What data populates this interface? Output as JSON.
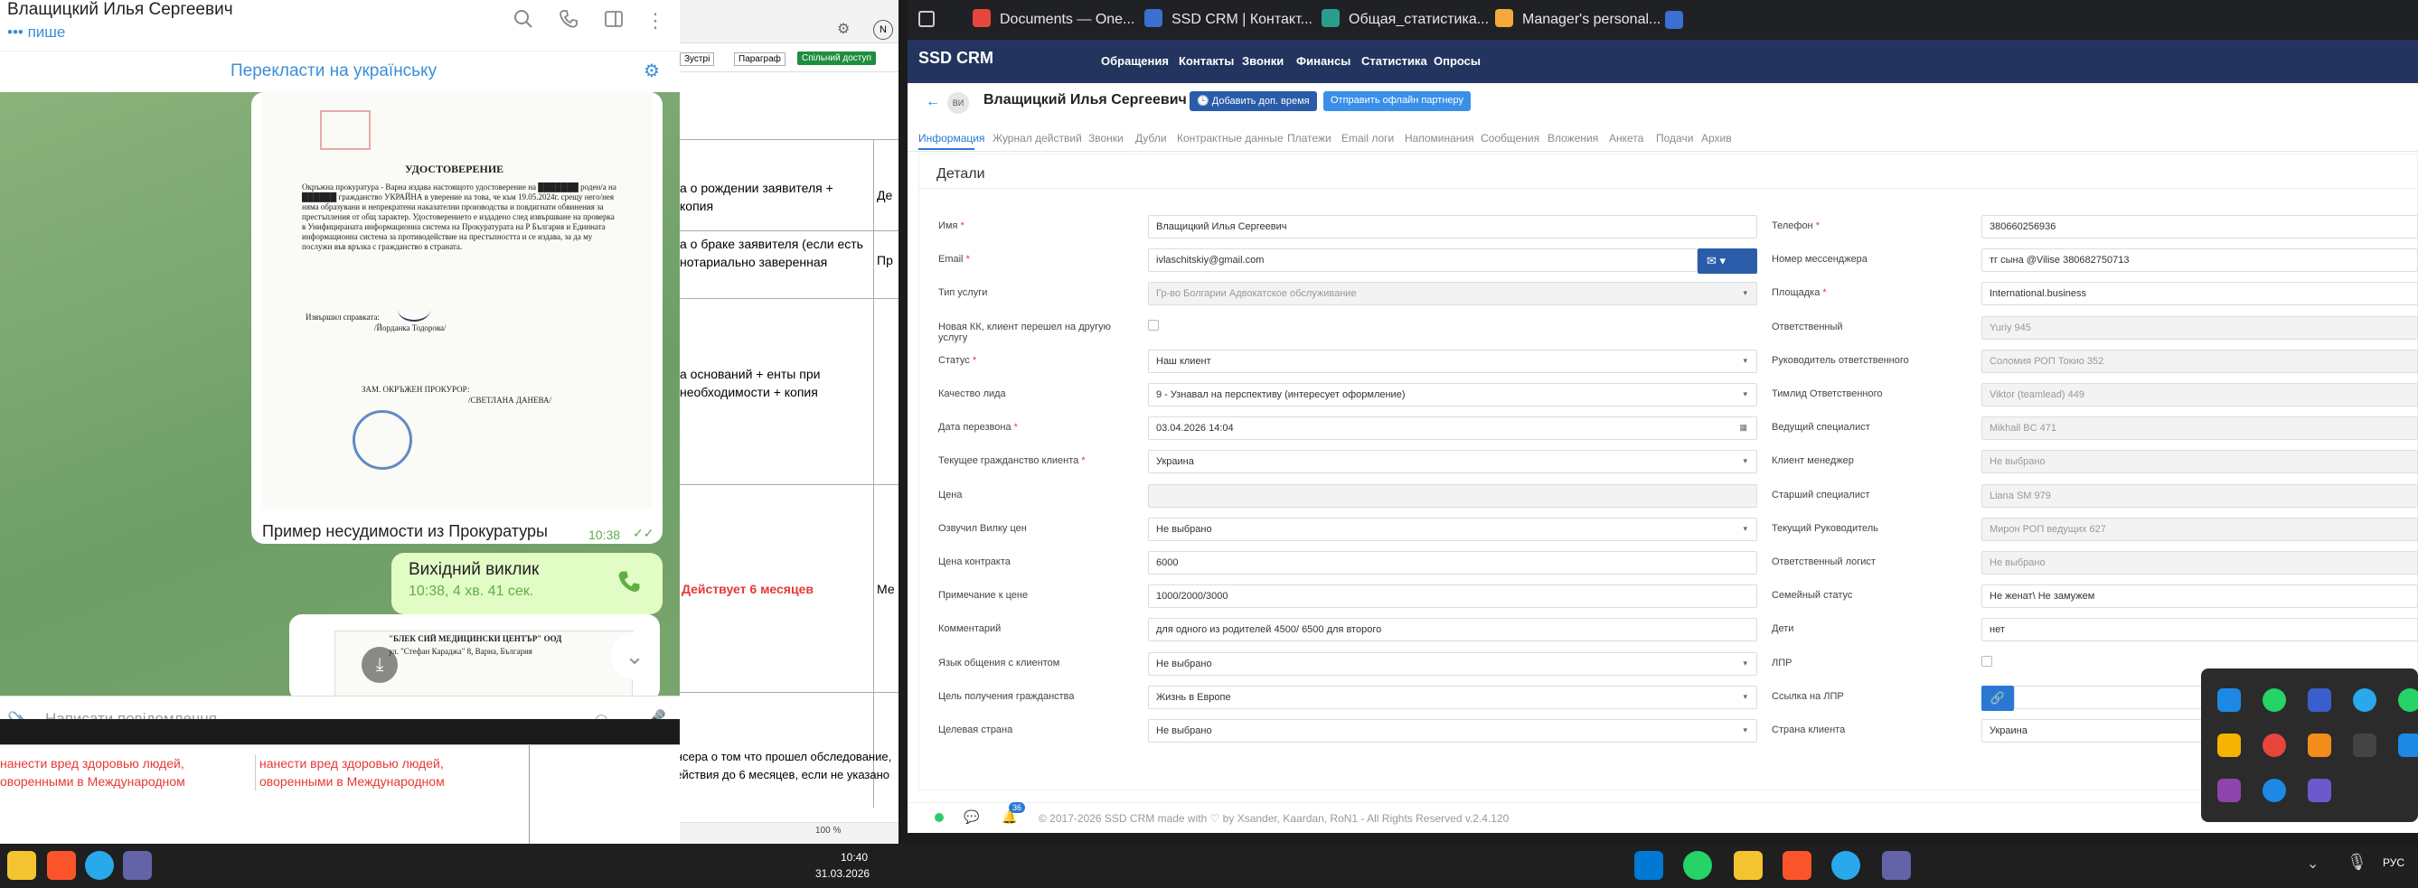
{
  "telegram": {
    "contact_name": "Влащицкий Илья Сергеевич",
    "status": "••• пише",
    "translate_label": "Перекласти на українську",
    "doc_title": "УДОСТОВЕРЕНИЕ",
    "doc_body": "Окръжна прокуратура - Варна издава настоящото удостоверение на ███████ роден/а на ██████ гражданство УКРАЙНА в уверение на това, че към 19.05.2024г. срещу него/нея няма образувани и непрекратени наказателни производства и повдигнати обвинения за престъпления от общ характер. Удостоверението е издадено след извършване на проверка в Унифицираната информационна система на Прокуратурата на Р България и Единната информационна система за противодействие на престъпността и се издава, за да му послужи във връзка с гражданство в страната.",
    "doc_signer_label": "Извършил справката:",
    "doc_signer": "/Йорданка Тодорова/",
    "doc_prosecutor_label": "ЗАМ. ОКРЪЖЕН ПРОКУРОР:",
    "doc_prosecutor": "/СВЕТЛАНА ДАНЕВА/",
    "message_caption": "Пример несудимости из Прокуратуры",
    "message_time": "10:38",
    "call_title": "Вихідний виклик",
    "call_sub": "10:38, 4 хв. 41 сек.",
    "doc2_line1": "\"БЛЕК СИЙ МЕДИЦИНСКИ ЦЕНТЪР\" ООД",
    "doc2_line2": "ул. \"Стефан Караджа\" 8, Варна, България",
    "compose_placeholder": "Написати повідомлення..."
  },
  "middle": {
    "menu_items": [
      "Зустрі",
      "Параграф",
      "Спільний доступ"
    ],
    "avatar_letter": "N",
    "rows": [
      {
        "text": "а о рождении заявителя + копия",
        "side": "Де"
      },
      {
        "text": "а о браке заявителя (если есть нотариально заверенная",
        "side": "Пр"
      },
      {
        "text": "а оснований + енты при необходимости + копия",
        "side": ""
      },
      {
        "text": "Действует 6 месяцев",
        "side": "Ме"
      },
      {
        "text": "Справка с психнерв диспансера о том что прошел обследование, психически здоров (срок действия до 6 месяцев, если не указано срок годности).",
        "side": ""
      }
    ],
    "red_text": "нанести вред здоровью людей, оворенными в Международном",
    "zoom": "100 %"
  },
  "browser_tabs": [
    {
      "label": "Documents — One...",
      "color": "#e8453c"
    },
    {
      "label": "SSD CRM | Контакт...",
      "color": "#3b6fd1"
    },
    {
      "label": "Общая_статистика...",
      "color": "#2a9d8f"
    },
    {
      "label": "Manager's personal...",
      "color": "#f4a93b"
    }
  ],
  "crm": {
    "logo": "SSD CRM",
    "nav": [
      "Обращения",
      "Контакты",
      "Звонки",
      "Финансы",
      "Статистика",
      "Опросы"
    ],
    "title": "Влащицкий Илья Сергеевич",
    "avatar": "ВИ",
    "btn_add_time": "Добавить доп. время",
    "btn_send_offline": "Отправить офлайн партнеру",
    "subtabs": [
      "Информация",
      "Журнал действий",
      "Звонки",
      "Дубли",
      "Контрактные данные",
      "Платежи",
      "Email логи",
      "Напоминания",
      "Сообщения",
      "Вложения",
      "Анкета",
      "Подачи",
      "Архив"
    ],
    "section_title": "Детали",
    "left_fields": [
      {
        "label": "Имя",
        "req": true,
        "value": "Влащицкий Илья Сергеевич",
        "kind": "text"
      },
      {
        "label": "Email",
        "req": true,
        "value": "ivlaschitskiy@gmail.com",
        "kind": "email"
      },
      {
        "label": "Тип услуги",
        "req": false,
        "value": "Гр-во Болгарии Адвокатское обслуживание",
        "kind": "select-dis"
      },
      {
        "label": "Новая КК, клиент перешел на другую услугу",
        "req": false,
        "value": "",
        "kind": "checkbox"
      },
      {
        "label": "Статус",
        "req": true,
        "value": "Наш клиент",
        "kind": "select"
      },
      {
        "label": "Качество лида",
        "req": false,
        "value": "9 - Узнавал на перспективу (интересует оформление)",
        "kind": "select"
      },
      {
        "label": "Дата перезвона",
        "req": true,
        "value": "03.04.2026 14:04",
        "kind": "date"
      },
      {
        "label": "Текущее гражданство клиента",
        "req": true,
        "value": "Украина",
        "kind": "select"
      },
      {
        "label": "Цена",
        "req": false,
        "value": "",
        "kind": "text-dis"
      },
      {
        "label": "Озвучил Вилку цен",
        "req": false,
        "value": "Не выбрано",
        "kind": "select"
      },
      {
        "label": "Цена контракта",
        "req": false,
        "value": "6000",
        "kind": "text"
      },
      {
        "label": "Примечание к цене",
        "req": false,
        "value": "1000/2000/3000",
        "kind": "text"
      },
      {
        "label": "Комментарий",
        "req": false,
        "value": "для одного из родителей 4500/ 6500 для второго",
        "kind": "text"
      },
      {
        "label": "Язык общения с клиентом",
        "req": false,
        "value": "Не выбрано",
        "kind": "select"
      },
      {
        "label": "Цель получения гражданства",
        "req": false,
        "value": "Жизнь в Европе",
        "kind": "select"
      },
      {
        "label": "Целевая страна",
        "req": false,
        "value": "Не выбрано",
        "kind": "select"
      }
    ],
    "right_fields": [
      {
        "label": "Телефон",
        "req": true,
        "value": "380660256936",
        "kind": "text"
      },
      {
        "label": "Номер мессенджера",
        "req": false,
        "value": "тг сына @Vilise 380682750713",
        "kind": "text"
      },
      {
        "label": "Площадка",
        "req": true,
        "value": "International.business",
        "kind": "text"
      },
      {
        "label": "Ответственный",
        "req": false,
        "value": "Yuriy 945",
        "kind": "dis"
      },
      {
        "label": "Руководитель ответственного",
        "req": false,
        "value": "Соломия РОП Токио 352",
        "kind": "dis"
      },
      {
        "label": "Тимлид Ответственного",
        "req": false,
        "value": "Viktor (teamlead) 449",
        "kind": "dis"
      },
      {
        "label": "Ведущий специалист",
        "req": false,
        "value": "Mikhail BC 471",
        "kind": "dis"
      },
      {
        "label": "Клиент менеджер",
        "req": false,
        "value": "Не выбрано",
        "kind": "dis"
      },
      {
        "label": "Старший специалист",
        "req": false,
        "value": "Liana SM 979",
        "kind": "dis"
      },
      {
        "label": "Текущий Руководитель",
        "req": false,
        "value": "Мирон РОП ведущих 627",
        "kind": "dis"
      },
      {
        "label": "Ответственный логист",
        "req": false,
        "value": "Не выбрано",
        "kind": "dis"
      },
      {
        "label": "Семейный статус",
        "req": false,
        "value": "Не женат\\ Не замужем",
        "kind": "text"
      },
      {
        "label": "Дети",
        "req": false,
        "value": "нет",
        "kind": "text"
      },
      {
        "label": "ЛПР",
        "req": false,
        "value": "",
        "kind": "checkbox"
      },
      {
        "label": "Ссылка на ЛПР",
        "req": false,
        "value": "",
        "kind": "link"
      },
      {
        "label": "Страна клиента",
        "req": false,
        "value": "Украина",
        "kind": "text"
      }
    ],
    "notif_count": "36",
    "footer": "© 2017-2026 SSD CRM made with ♡ by Xsander, Kaardan, RoN1 - All Rights Reserved v.2.4.120"
  },
  "taskbar": {
    "time": "10:40",
    "date": "31.03.2026",
    "lang": "РУС"
  }
}
